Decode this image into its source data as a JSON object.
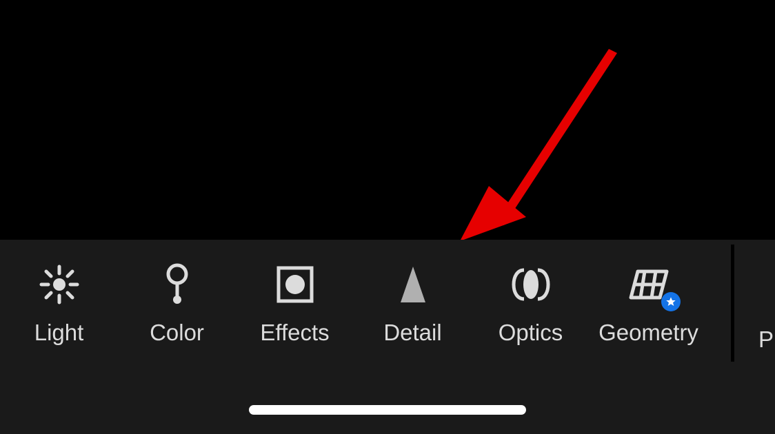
{
  "toolbar": {
    "items": [
      {
        "id": "light",
        "label": "Light"
      },
      {
        "id": "color",
        "label": "Color"
      },
      {
        "id": "effects",
        "label": "Effects"
      },
      {
        "id": "detail",
        "label": "Detail"
      },
      {
        "id": "optics",
        "label": "Optics"
      },
      {
        "id": "geometry",
        "label": "Geometry",
        "badge": "star"
      }
    ],
    "partial_next_label": "Pr"
  },
  "annotation": {
    "arrow_points_to": "detail"
  }
}
